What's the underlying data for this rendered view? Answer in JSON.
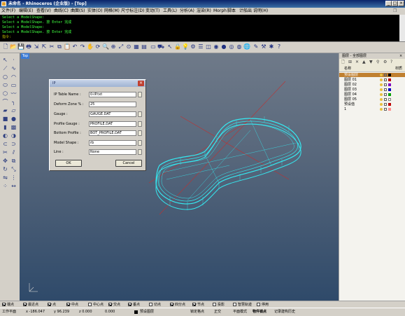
{
  "window": {
    "title": "未命名 - Rhinoceros (企业版) - [Top]",
    "controls": [
      "_",
      "□",
      "×"
    ]
  },
  "menu": [
    "文件(F)",
    "编辑(E)",
    "查看(V)",
    "曲线(C)",
    "曲面(S)",
    "实体(O)",
    "网格(M)",
    "尺寸标注(D)",
    "变动(T)",
    "工具(L)",
    "分析(A)",
    "渲染(R)",
    "Morph",
    "脚本",
    "计船出",
    "说明(H)"
  ],
  "command_history": [
    "Select a ModelShape:",
    "Select a ModelShape. 按 Enter 完成",
    "Select a ModelShape:",
    "Select a ModelShape. 按 Enter 完成"
  ],
  "command_prompt": "指令:",
  "viewport": {
    "tab": "Top"
  },
  "dialog": {
    "title": "IP",
    "fields": [
      {
        "label": "IP Table Name :",
        "value": "0-IP.txt"
      },
      {
        "label": "Deform Zone % :",
        "value": "25"
      },
      {
        "label": "Gauge :",
        "value": "GAUGE.DAT"
      },
      {
        "label": "Profile Gauge :",
        "value": "PROFILE.DAT"
      },
      {
        "label": "Bottom Profile :",
        "value": "BOT_PROFILE.DAT"
      },
      {
        "label": "Model Shape :",
        "value": "rb"
      },
      {
        "label": "Line :",
        "value": "None"
      }
    ],
    "ok_label": "OK",
    "cancel_label": "Cancel"
  },
  "layers_panel": {
    "title": "图层 - 全部图层",
    "col_name": "名称",
    "col_material": "材质",
    "layers": [
      {
        "name": "预设图层",
        "color": "#000000",
        "current": true
      },
      {
        "name": "图层 01",
        "color": "#c00000"
      },
      {
        "name": "图层 02",
        "color": "#8000c0"
      },
      {
        "name": "图层 03",
        "color": "#0000c0"
      },
      {
        "name": "图层 04",
        "color": "#00a000"
      },
      {
        "name": "图层 05",
        "color": "#ffffff"
      },
      {
        "name": "预设值",
        "color": "#c00000"
      },
      {
        "name": "1",
        "color": "#ff9090"
      }
    ]
  },
  "osnaps": [
    {
      "label": "端点",
      "checked": true
    },
    {
      "label": "最近点",
      "checked": true
    },
    {
      "label": "点",
      "checked": true
    },
    {
      "label": "中点",
      "checked": true
    },
    {
      "label": "中心点",
      "checked": false
    },
    {
      "label": "交点",
      "checked": true
    },
    {
      "label": "垂点",
      "checked": true
    },
    {
      "label": "切点",
      "checked": false
    },
    {
      "label": "四分点",
      "checked": true
    },
    {
      "label": "节点",
      "checked": true
    },
    {
      "label": "投影",
      "checked": false
    },
    {
      "label": "智慧轨迹",
      "checked": false
    },
    {
      "label": "停用",
      "checked": false
    }
  ],
  "status": {
    "plane": "工作平面",
    "x": "x -186.047",
    "y": "y 96.239",
    "z": "z 0.000",
    "dist": "0.000",
    "layer": "预设图层",
    "grid_snap": "锁定格点",
    "ortho": "正交",
    "planar": "平面模式",
    "object_snap": "物件锁点",
    "history": "记录建构历史"
  },
  "colors": {
    "shoe_wire": "#35e8f0",
    "axis_red": "#c03030",
    "titlebar": "#0a246a"
  }
}
